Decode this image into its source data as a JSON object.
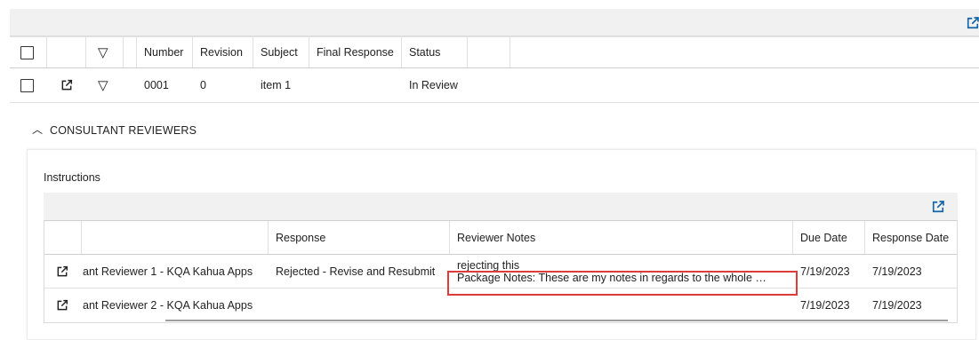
{
  "outer_grid": {
    "columns": [
      "Number",
      "Revision",
      "Subject",
      "Final Response",
      "Status"
    ],
    "rows": [
      {
        "number": "0001",
        "revision": "0",
        "subject": "item 1",
        "final_response": "",
        "status": "In Review"
      }
    ]
  },
  "consultant": {
    "section_title": "CONSULTANT REVIEWERS",
    "instructions_label": "Instructions",
    "columns": [
      "",
      "Response",
      "Reviewer Notes",
      "Due Date",
      "Response Date"
    ],
    "rows": [
      {
        "reviewer": "ant Reviewer 1 - KQA Kahua Apps",
        "response": "Rejected - Revise and Resubmit",
        "notes_line1": "rejecting this",
        "notes_line2": "Package Notes: These are my notes in regards to the whole …",
        "due_date": "7/19/2023",
        "response_date": "7/19/2023"
      },
      {
        "reviewer": "ant Reviewer 2 - KQA Kahua Apps",
        "response": "",
        "notes_line1": "",
        "notes_line2": "",
        "due_date": "7/19/2023",
        "response_date": "7/19/2023"
      }
    ]
  },
  "colors": {
    "accent": "#1565a8",
    "highlight": "#e03b3b",
    "toolbar": "#f1f1f1"
  },
  "icons": [
    "external-link-icon",
    "filter-triangle-icon",
    "chevron-up-icon",
    "checkbox-icon"
  ]
}
